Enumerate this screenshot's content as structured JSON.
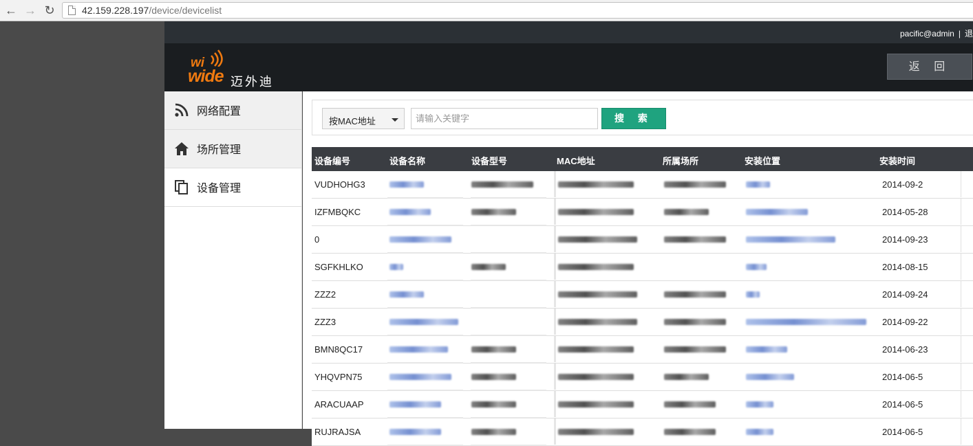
{
  "browser": {
    "url_host": "42.159.228.197",
    "url_path": "/device/devicelist"
  },
  "topbar": {
    "user": "pacific@admin",
    "separator": "|",
    "logout": "退"
  },
  "header": {
    "logo_wi": "wi",
    "logo_wide": "wide",
    "logo_brand": "迈外迪",
    "back_label": "返 回"
  },
  "sidebar": {
    "items": [
      {
        "label": "网络配置",
        "icon": "rss-icon"
      },
      {
        "label": "场所管理",
        "icon": "home-icon"
      },
      {
        "label": "设备管理",
        "icon": "copy-icon"
      }
    ]
  },
  "search": {
    "select_value": "按MAC地址",
    "placeholder": "请输入关键字",
    "button_label": "搜 索"
  },
  "table": {
    "columns": [
      "设备编号",
      "设备名称",
      "设备型号",
      "MAC地址",
      "所属场所",
      "安装位置",
      "安装时间"
    ],
    "rows": [
      {
        "id": "VUDHOHG3",
        "time": "2014-09-2"
      },
      {
        "id": "IZFMBQKC",
        "time": "2014-05-28"
      },
      {
        "id": "0",
        "time": "2014-09-23"
      },
      {
        "id": "SGFKHLKO",
        "time": "2014-08-15"
      },
      {
        "id": "ZZZ2",
        "time": "2014-09-24"
      },
      {
        "id": "ZZZ3",
        "time": "2014-09-22"
      },
      {
        "id": "BMN8QC17",
        "time": "2014-06-23"
      },
      {
        "id": "YHQVPN75",
        "time": "2014-06-5"
      },
      {
        "id": "ARACUAAP",
        "time": "2014-06-5"
      },
      {
        "id": "RUJRAJSA",
        "time": "2014-06-5"
      }
    ]
  },
  "colors": {
    "search_button": "#1fa37f",
    "logo_orange": "#f07a10",
    "table_header": "#3a3d42"
  }
}
